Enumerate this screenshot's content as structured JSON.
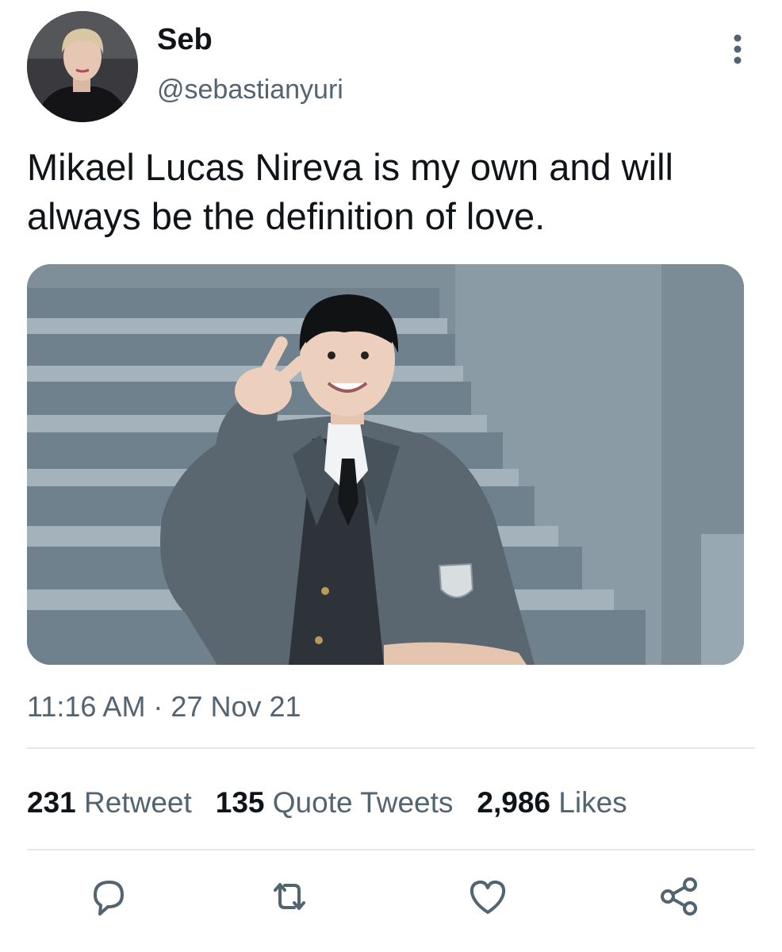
{
  "user": {
    "display_name": "Seb",
    "handle": "@sebastianyuri",
    "avatar_icon": "profile-photo"
  },
  "tweet": {
    "text": "Mikael Lucas Nireva is my own and will always be the definition of love.",
    "timestamp": "11:16 AM · 27 Nov 21",
    "media_icon": "photo-of-person-in-school-uniform-on-stairs"
  },
  "stats": {
    "retweets_count": "231",
    "retweets_label": "Retweet",
    "quotes_count": "135",
    "quotes_label": "Quote Tweets",
    "likes_count": "2,986",
    "likes_label": "Likes"
  },
  "actions": {
    "reply_icon": "reply-icon",
    "retweet_icon": "retweet-icon",
    "like_icon": "heart-icon",
    "share_icon": "share-icon"
  },
  "colors": {
    "text_primary": "#0f1419",
    "text_secondary": "#536471",
    "divider": "#e3e7ea",
    "icon": "#536471"
  }
}
